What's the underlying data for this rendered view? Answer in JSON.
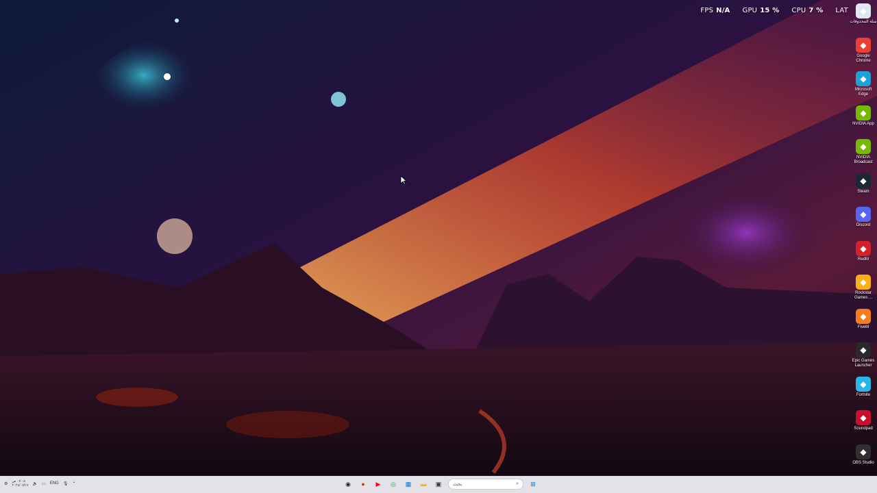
{
  "hud": {
    "fps_label": "FPS",
    "fps_value": "N/A",
    "gpu_label": "GPU",
    "gpu_value": "15 %",
    "cpu_label": "CPU",
    "cpu_value": "7 %",
    "lang": "LAT"
  },
  "desktop_icons": [
    {
      "label": "سلة المحذوفات",
      "icon": "recycle-bin-icon",
      "color": "#dfe8f0"
    },
    {
      "label": "Google Chrome",
      "icon": "chrome-icon",
      "color": "#e94235"
    },
    {
      "label": "Microsoft Edge",
      "icon": "edge-icon",
      "color": "#1da1d8"
    },
    {
      "label": "NVIDIA App",
      "icon": "nvidia-icon",
      "color": "#76b900"
    },
    {
      "label": "NVIDIA Broadcast",
      "icon": "nvidia-broadcast-icon",
      "color": "#76b900"
    },
    {
      "label": "Steam",
      "icon": "steam-icon",
      "color": "#1b2838"
    },
    {
      "label": "Discord",
      "icon": "discord-icon",
      "color": "#5865f2"
    },
    {
      "label": "RedM",
      "icon": "redm-icon",
      "color": "#d4202a"
    },
    {
      "label": "Rockstar Games ...",
      "icon": "rockstar-icon",
      "color": "#fcaf17"
    },
    {
      "label": "FiveM",
      "icon": "fivem-icon",
      "color": "#f57c1f"
    },
    {
      "label": "Epic Games Launcher",
      "icon": "epic-icon",
      "color": "#2a2a2a"
    },
    {
      "label": "Fortnite",
      "icon": "fortnite-icon",
      "color": "#2bb5e8"
    },
    {
      "label": "Soundpad",
      "icon": "soundpad-icon",
      "color": "#c8102e"
    },
    {
      "label": "OBS Studio",
      "icon": "obs-icon",
      "color": "#302e31"
    }
  ],
  "taskbar": {
    "clock_time": "٠٧:٠٨ ص",
    "clock_date": "٢٠٢٤/٠٧/١٧",
    "lang": "ENG",
    "search_placeholder": "بحث",
    "apps": [
      {
        "name": "steam-taskbar-icon",
        "color": "#1b2838",
        "glyph": "◉"
      },
      {
        "name": "app-taskbar-icon",
        "color": "#c0392b",
        "glyph": "●"
      },
      {
        "name": "youtube-taskbar-icon",
        "color": "#ff0000",
        "glyph": "▶"
      },
      {
        "name": "chrome-taskbar-icon",
        "color": "#34a853",
        "glyph": "◎"
      },
      {
        "name": "store-taskbar-icon",
        "color": "#0078d4",
        "glyph": "▦"
      },
      {
        "name": "explorer-taskbar-icon",
        "color": "#f4b400",
        "glyph": "▬"
      },
      {
        "name": "terminal-taskbar-icon",
        "color": "#333333",
        "glyph": "▣"
      }
    ]
  }
}
